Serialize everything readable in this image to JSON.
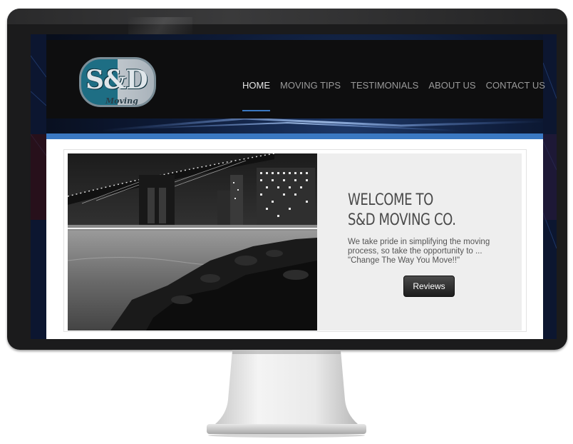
{
  "header": {
    "logo_text": "S&D",
    "logo_subtext": "Moving"
  },
  "nav": {
    "items": [
      {
        "label": "HOME",
        "active": true
      },
      {
        "label": "MOVING TIPS",
        "active": false
      },
      {
        "label": "TESTIMONIALS",
        "active": false
      },
      {
        "label": "ABOUT US",
        "active": false
      },
      {
        "label": "CONTACT US",
        "active": false
      }
    ]
  },
  "hero": {
    "title_line1": "WELCOME TO",
    "title_line2": "S&D MOVING CO.",
    "description": "We take pride in simplifying the moving process, so take the opportunity to ... \"Change The Way You Move!!\"",
    "button_label": "Reviews"
  },
  "colors": {
    "accent": "#3a78c2",
    "header_bg": "#0e0e0f",
    "logo_teal": "#1e6e84"
  }
}
